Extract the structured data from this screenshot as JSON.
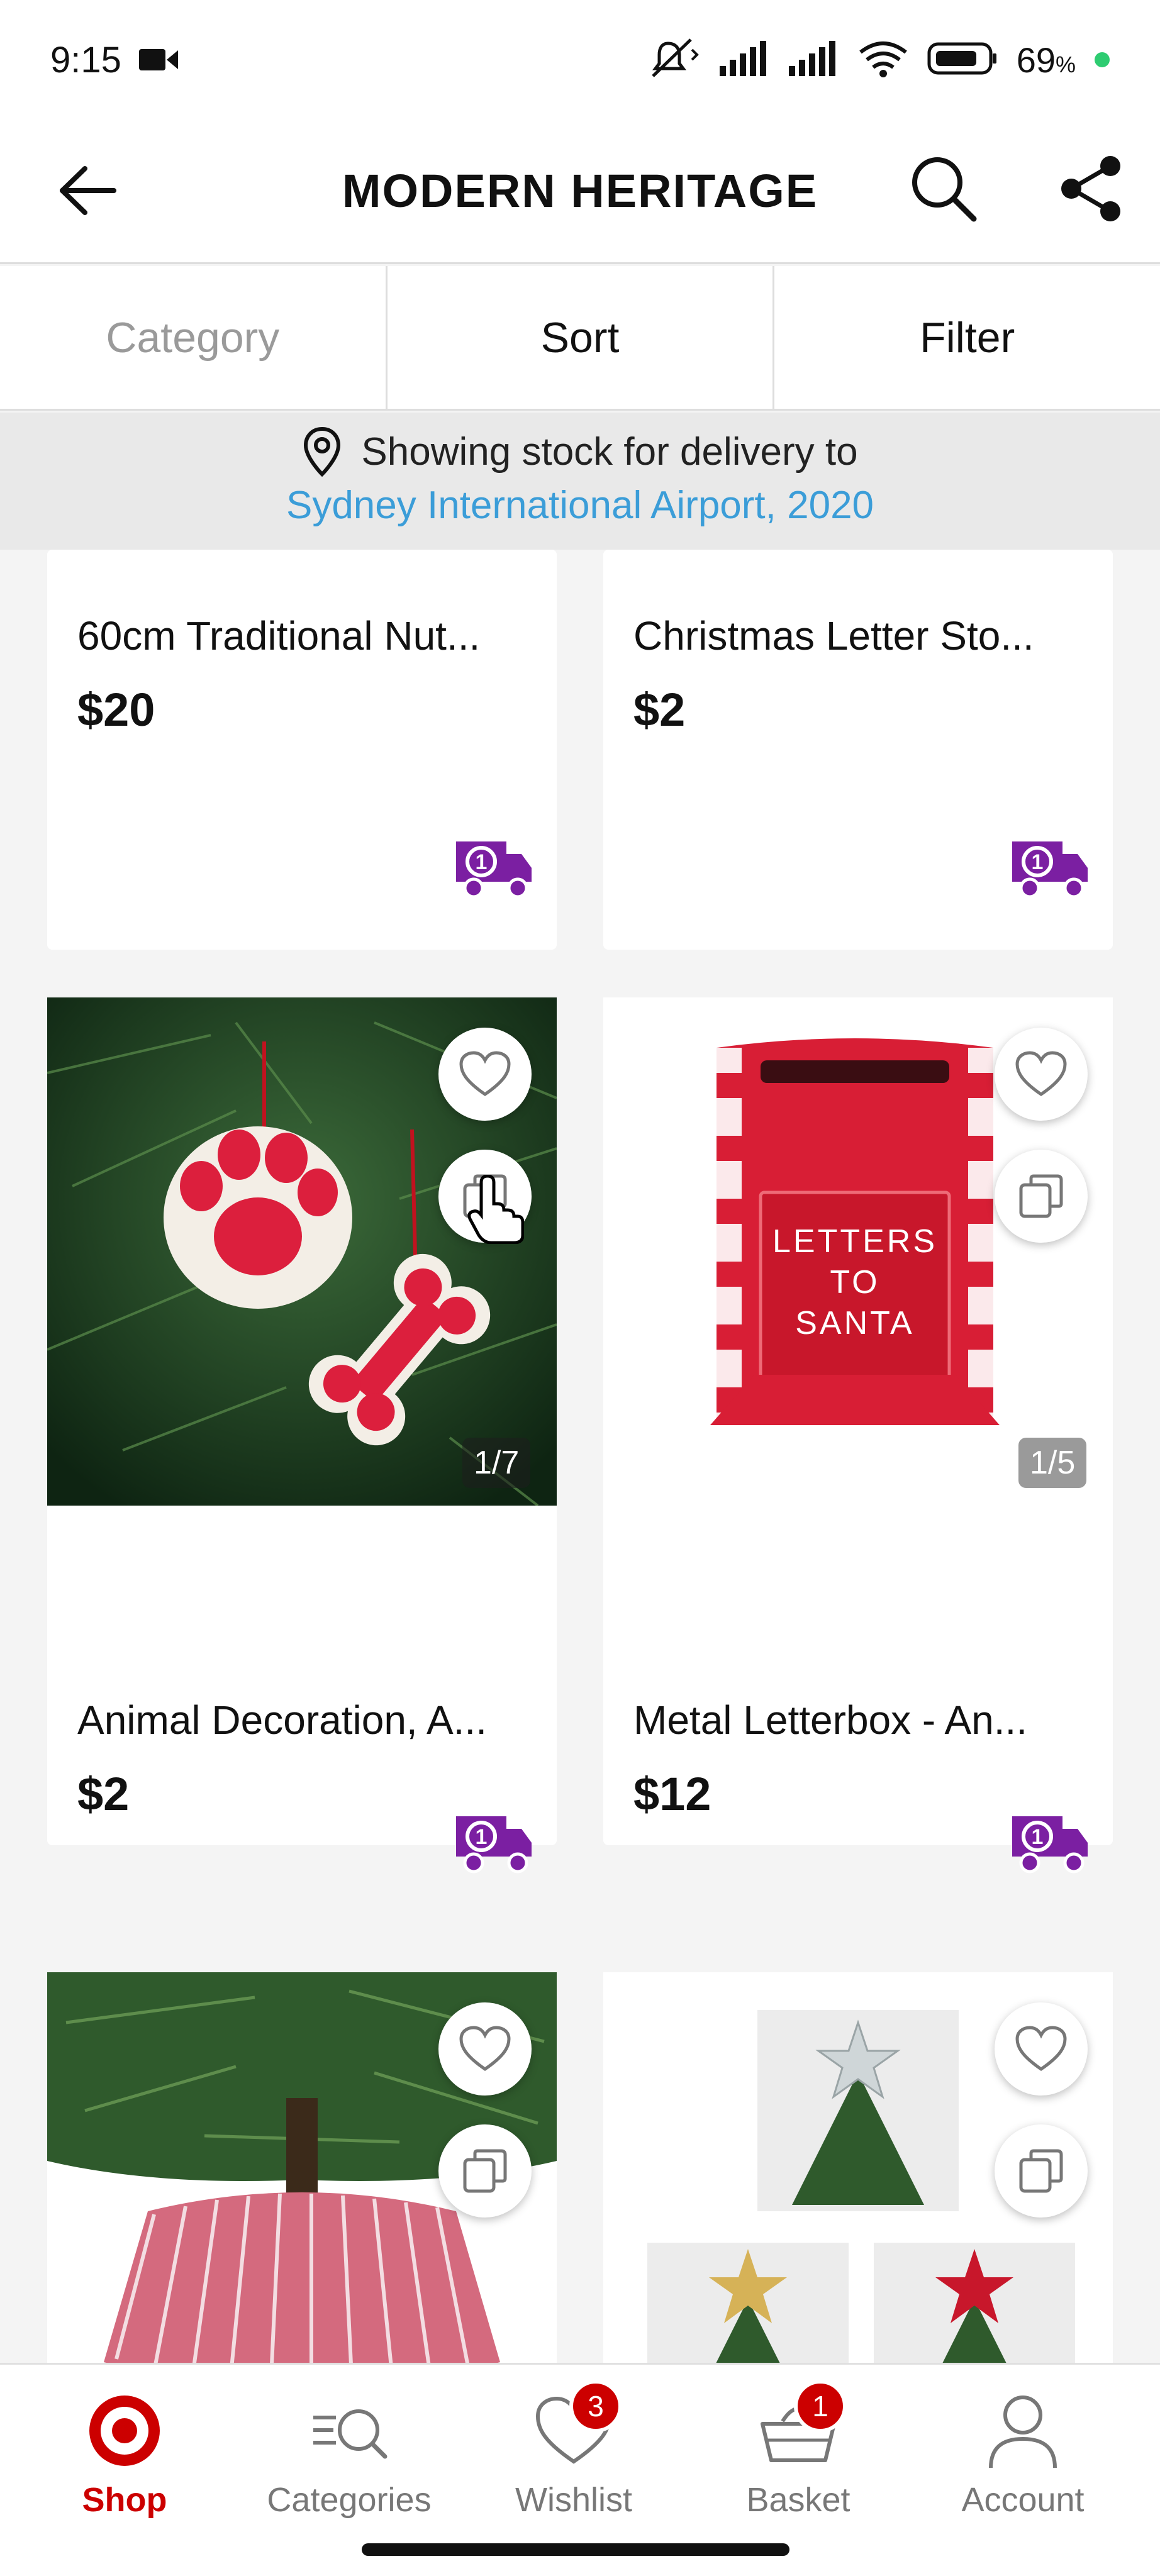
{
  "status_bar": {
    "time": "9:15",
    "battery": "69",
    "battery_unit": "%"
  },
  "header": {
    "title": "MODERN HERITAGE"
  },
  "tabs": [
    {
      "label": "Category",
      "enabled": false
    },
    {
      "label": "Sort",
      "enabled": true
    },
    {
      "label": "Filter",
      "enabled": true
    }
  ],
  "delivery": {
    "prefix": "Showing stock for delivery to",
    "location": "Sydney International Airport, 2020"
  },
  "products": [
    {
      "name": "60cm Traditional Nut...",
      "price": "$20"
    },
    {
      "name": "Christmas Letter Sto...",
      "price": "$2"
    },
    {
      "name": "Animal Decoration, A...",
      "price": "$2",
      "image_counter": "1/7",
      "image_desc": "paw and bone ornaments on tree"
    },
    {
      "name": "Metal Letterbox - An...",
      "price": "$12",
      "image_counter": "1/5",
      "image_text": [
        "LETTERS",
        "TO",
        "SANTA"
      ]
    },
    {
      "name": "",
      "price": "",
      "image_desc": "tree skirt collar"
    },
    {
      "name": "",
      "price": "",
      "image_desc": "tree toppers"
    }
  ],
  "bottom_nav": [
    {
      "label": "Shop",
      "icon": "target-logo-icon",
      "active": true
    },
    {
      "label": "Categories",
      "icon": "categories-search-icon",
      "active": false
    },
    {
      "label": "Wishlist",
      "icon": "heart-icon",
      "active": false,
      "badge": "3"
    },
    {
      "label": "Basket",
      "icon": "basket-icon",
      "active": false,
      "badge": "1"
    },
    {
      "label": "Account",
      "icon": "person-icon",
      "active": false
    }
  ],
  "colors": {
    "brand_red": "#cc0000",
    "link_blue": "#3b9dd8",
    "delivery_purple": "#7b1fa2"
  }
}
